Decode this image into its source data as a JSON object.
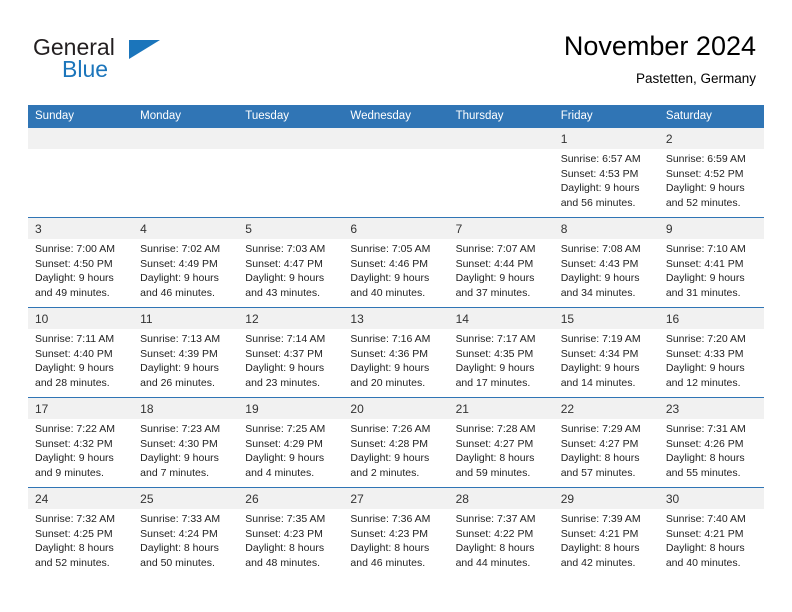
{
  "brand": {
    "name_top": "General",
    "name_bottom": "Blue",
    "color_blue": "#1b75bb",
    "color_dark": "#231f20"
  },
  "header": {
    "title": "November 2024",
    "subtitle": "Pastetten, Germany"
  },
  "colors": {
    "header_row": "#3075b5",
    "daynum_band": "#f1f1f1",
    "grid_line": "#3075b5"
  },
  "weekday_headers": [
    "Sunday",
    "Monday",
    "Tuesday",
    "Wednesday",
    "Thursday",
    "Friday",
    "Saturday"
  ],
  "weeks": [
    [
      {
        "day": "",
        "empty": true,
        "sunrise": "",
        "sunset": "",
        "daylight_1": "",
        "daylight_2": ""
      },
      {
        "day": "",
        "empty": true,
        "sunrise": "",
        "sunset": "",
        "daylight_1": "",
        "daylight_2": ""
      },
      {
        "day": "",
        "empty": true,
        "sunrise": "",
        "sunset": "",
        "daylight_1": "",
        "daylight_2": ""
      },
      {
        "day": "",
        "empty": true,
        "sunrise": "",
        "sunset": "",
        "daylight_1": "",
        "daylight_2": ""
      },
      {
        "day": "",
        "empty": true,
        "sunrise": "",
        "sunset": "",
        "daylight_1": "",
        "daylight_2": ""
      },
      {
        "day": "1",
        "sunrise": "Sunrise: 6:57 AM",
        "sunset": "Sunset: 4:53 PM",
        "daylight_1": "Daylight: 9 hours",
        "daylight_2": "and 56 minutes."
      },
      {
        "day": "2",
        "sunrise": "Sunrise: 6:59 AM",
        "sunset": "Sunset: 4:52 PM",
        "daylight_1": "Daylight: 9 hours",
        "daylight_2": "and 52 minutes."
      }
    ],
    [
      {
        "day": "3",
        "sunrise": "Sunrise: 7:00 AM",
        "sunset": "Sunset: 4:50 PM",
        "daylight_1": "Daylight: 9 hours",
        "daylight_2": "and 49 minutes."
      },
      {
        "day": "4",
        "sunrise": "Sunrise: 7:02 AM",
        "sunset": "Sunset: 4:49 PM",
        "daylight_1": "Daylight: 9 hours",
        "daylight_2": "and 46 minutes."
      },
      {
        "day": "5",
        "sunrise": "Sunrise: 7:03 AM",
        "sunset": "Sunset: 4:47 PM",
        "daylight_1": "Daylight: 9 hours",
        "daylight_2": "and 43 minutes."
      },
      {
        "day": "6",
        "sunrise": "Sunrise: 7:05 AM",
        "sunset": "Sunset: 4:46 PM",
        "daylight_1": "Daylight: 9 hours",
        "daylight_2": "and 40 minutes."
      },
      {
        "day": "7",
        "sunrise": "Sunrise: 7:07 AM",
        "sunset": "Sunset: 4:44 PM",
        "daylight_1": "Daylight: 9 hours",
        "daylight_2": "and 37 minutes."
      },
      {
        "day": "8",
        "sunrise": "Sunrise: 7:08 AM",
        "sunset": "Sunset: 4:43 PM",
        "daylight_1": "Daylight: 9 hours",
        "daylight_2": "and 34 minutes."
      },
      {
        "day": "9",
        "sunrise": "Sunrise: 7:10 AM",
        "sunset": "Sunset: 4:41 PM",
        "daylight_1": "Daylight: 9 hours",
        "daylight_2": "and 31 minutes."
      }
    ],
    [
      {
        "day": "10",
        "sunrise": "Sunrise: 7:11 AM",
        "sunset": "Sunset: 4:40 PM",
        "daylight_1": "Daylight: 9 hours",
        "daylight_2": "and 28 minutes."
      },
      {
        "day": "11",
        "sunrise": "Sunrise: 7:13 AM",
        "sunset": "Sunset: 4:39 PM",
        "daylight_1": "Daylight: 9 hours",
        "daylight_2": "and 26 minutes."
      },
      {
        "day": "12",
        "sunrise": "Sunrise: 7:14 AM",
        "sunset": "Sunset: 4:37 PM",
        "daylight_1": "Daylight: 9 hours",
        "daylight_2": "and 23 minutes."
      },
      {
        "day": "13",
        "sunrise": "Sunrise: 7:16 AM",
        "sunset": "Sunset: 4:36 PM",
        "daylight_1": "Daylight: 9 hours",
        "daylight_2": "and 20 minutes."
      },
      {
        "day": "14",
        "sunrise": "Sunrise: 7:17 AM",
        "sunset": "Sunset: 4:35 PM",
        "daylight_1": "Daylight: 9 hours",
        "daylight_2": "and 17 minutes."
      },
      {
        "day": "15",
        "sunrise": "Sunrise: 7:19 AM",
        "sunset": "Sunset: 4:34 PM",
        "daylight_1": "Daylight: 9 hours",
        "daylight_2": "and 14 minutes."
      },
      {
        "day": "16",
        "sunrise": "Sunrise: 7:20 AM",
        "sunset": "Sunset: 4:33 PM",
        "daylight_1": "Daylight: 9 hours",
        "daylight_2": "and 12 minutes."
      }
    ],
    [
      {
        "day": "17",
        "sunrise": "Sunrise: 7:22 AM",
        "sunset": "Sunset: 4:32 PM",
        "daylight_1": "Daylight: 9 hours",
        "daylight_2": "and 9 minutes."
      },
      {
        "day": "18",
        "sunrise": "Sunrise: 7:23 AM",
        "sunset": "Sunset: 4:30 PM",
        "daylight_1": "Daylight: 9 hours",
        "daylight_2": "and 7 minutes."
      },
      {
        "day": "19",
        "sunrise": "Sunrise: 7:25 AM",
        "sunset": "Sunset: 4:29 PM",
        "daylight_1": "Daylight: 9 hours",
        "daylight_2": "and 4 minutes."
      },
      {
        "day": "20",
        "sunrise": "Sunrise: 7:26 AM",
        "sunset": "Sunset: 4:28 PM",
        "daylight_1": "Daylight: 9 hours",
        "daylight_2": "and 2 minutes."
      },
      {
        "day": "21",
        "sunrise": "Sunrise: 7:28 AM",
        "sunset": "Sunset: 4:27 PM",
        "daylight_1": "Daylight: 8 hours",
        "daylight_2": "and 59 minutes."
      },
      {
        "day": "22",
        "sunrise": "Sunrise: 7:29 AM",
        "sunset": "Sunset: 4:27 PM",
        "daylight_1": "Daylight: 8 hours",
        "daylight_2": "and 57 minutes."
      },
      {
        "day": "23",
        "sunrise": "Sunrise: 7:31 AM",
        "sunset": "Sunset: 4:26 PM",
        "daylight_1": "Daylight: 8 hours",
        "daylight_2": "and 55 minutes."
      }
    ],
    [
      {
        "day": "24",
        "sunrise": "Sunrise: 7:32 AM",
        "sunset": "Sunset: 4:25 PM",
        "daylight_1": "Daylight: 8 hours",
        "daylight_2": "and 52 minutes."
      },
      {
        "day": "25",
        "sunrise": "Sunrise: 7:33 AM",
        "sunset": "Sunset: 4:24 PM",
        "daylight_1": "Daylight: 8 hours",
        "daylight_2": "and 50 minutes."
      },
      {
        "day": "26",
        "sunrise": "Sunrise: 7:35 AM",
        "sunset": "Sunset: 4:23 PM",
        "daylight_1": "Daylight: 8 hours",
        "daylight_2": "and 48 minutes."
      },
      {
        "day": "27",
        "sunrise": "Sunrise: 7:36 AM",
        "sunset": "Sunset: 4:23 PM",
        "daylight_1": "Daylight: 8 hours",
        "daylight_2": "and 46 minutes."
      },
      {
        "day": "28",
        "sunrise": "Sunrise: 7:37 AM",
        "sunset": "Sunset: 4:22 PM",
        "daylight_1": "Daylight: 8 hours",
        "daylight_2": "and 44 minutes."
      },
      {
        "day": "29",
        "sunrise": "Sunrise: 7:39 AM",
        "sunset": "Sunset: 4:21 PM",
        "daylight_1": "Daylight: 8 hours",
        "daylight_2": "and 42 minutes."
      },
      {
        "day": "30",
        "sunrise": "Sunrise: 7:40 AM",
        "sunset": "Sunset: 4:21 PM",
        "daylight_1": "Daylight: 8 hours",
        "daylight_2": "and 40 minutes."
      }
    ]
  ]
}
